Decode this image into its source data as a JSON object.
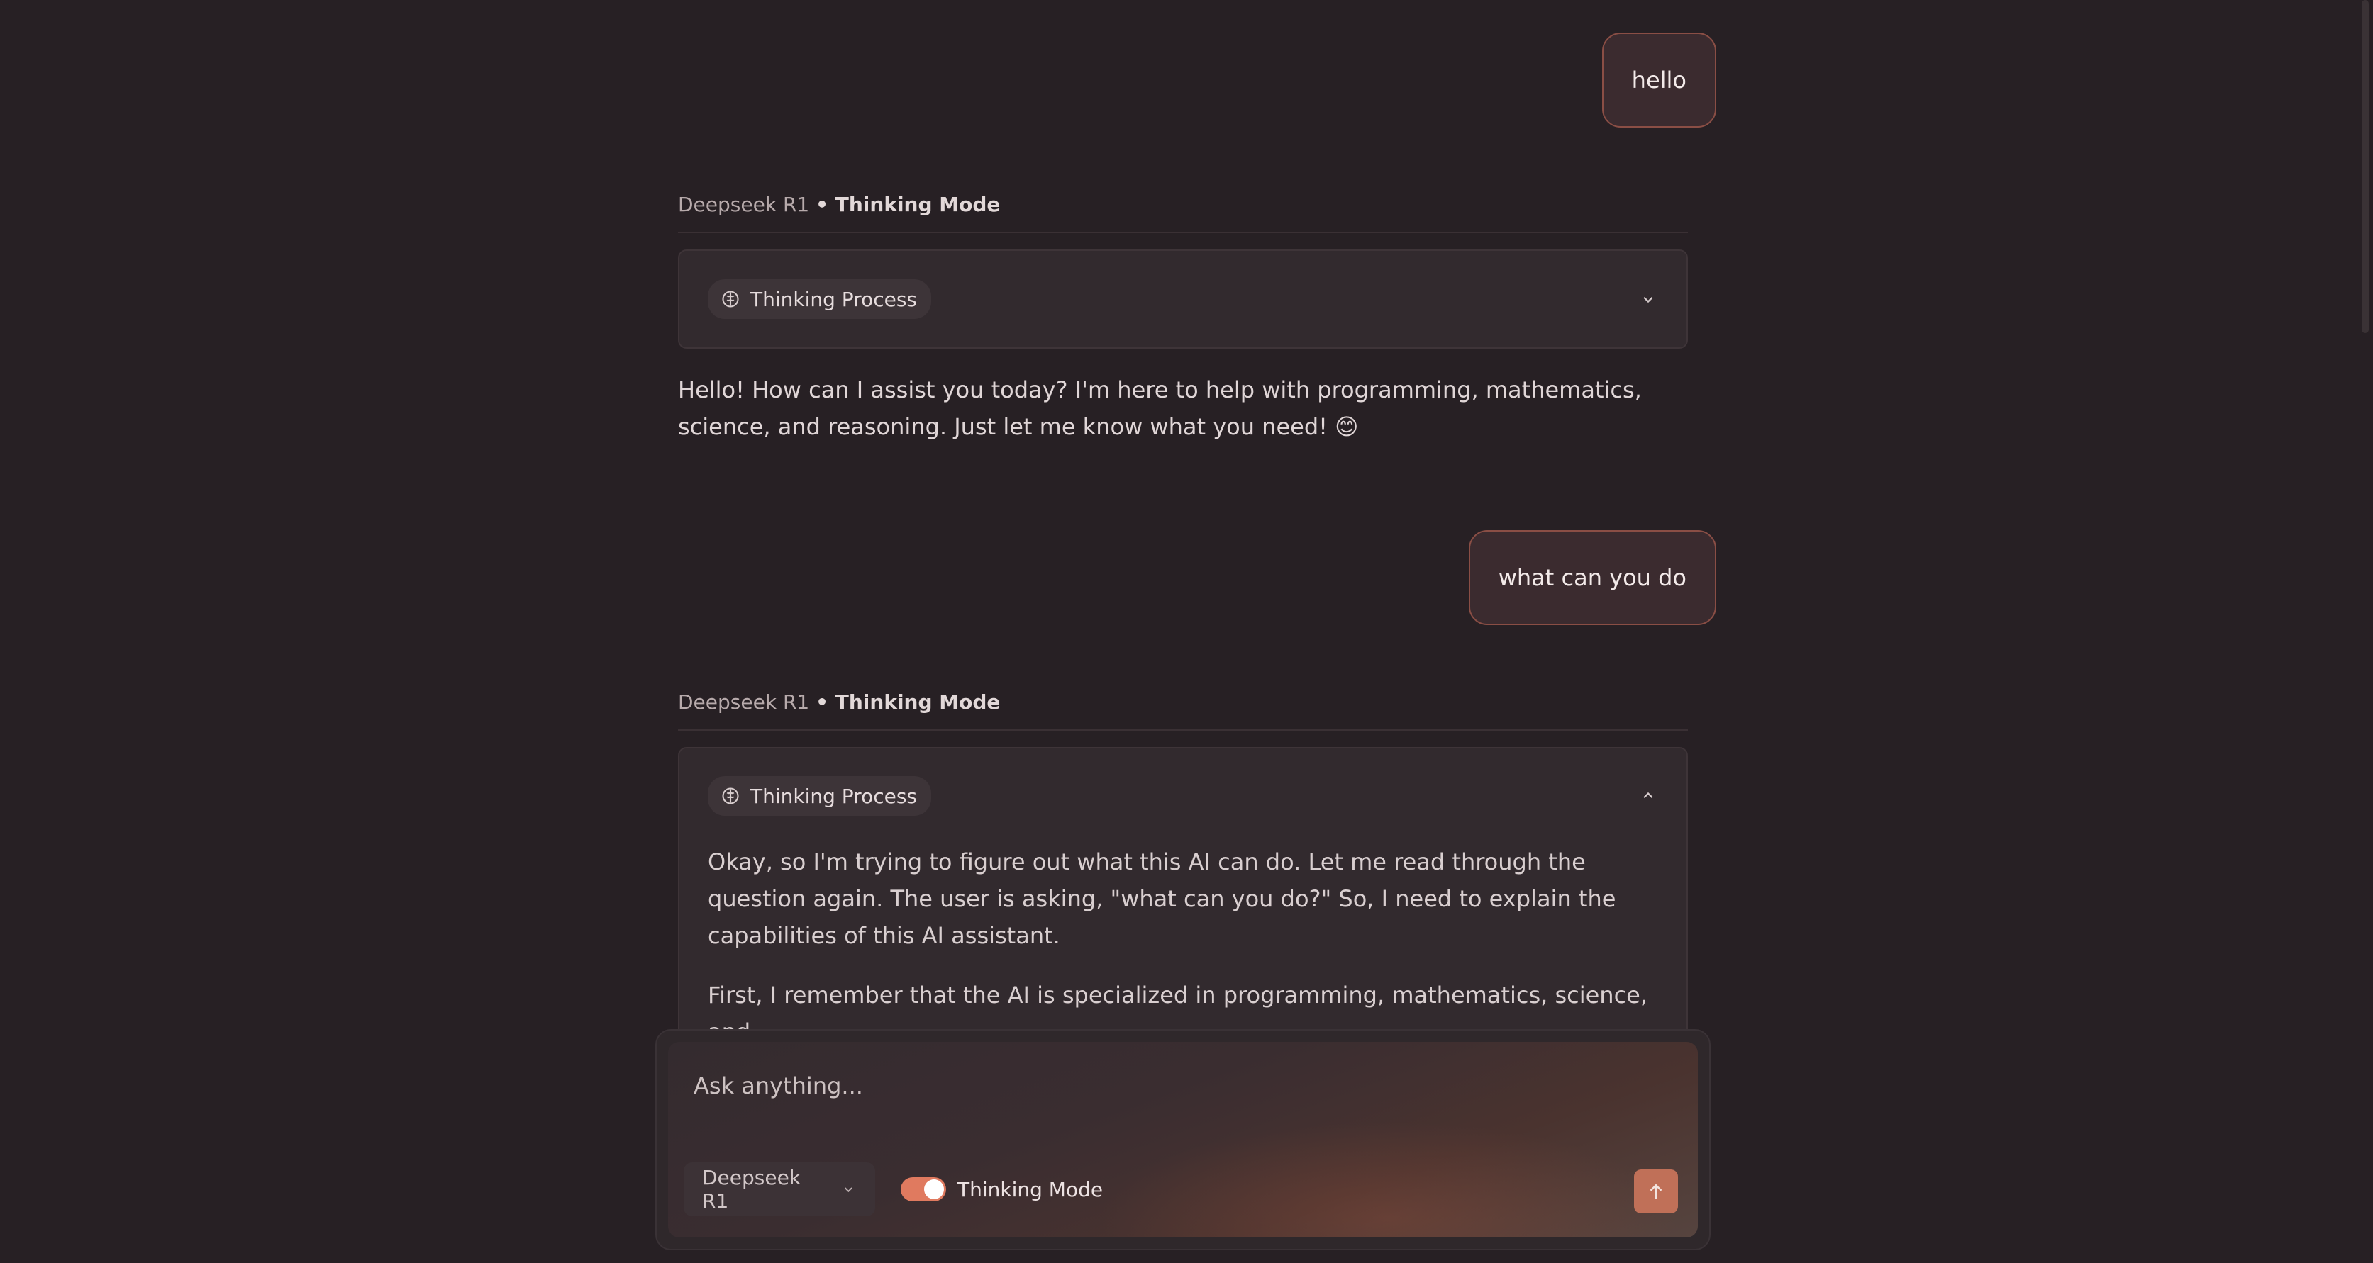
{
  "conversation": [
    {
      "role": "user",
      "text": "hello"
    },
    {
      "role": "assistant",
      "model": "Deepseek R1",
      "mode": "• Thinking Mode",
      "thinking_label": "Thinking Process",
      "thinking_expanded": false,
      "answer": "Hello! How can I assist you today? I'm here to help with programming, mathematics, science, and reasoning. Just let me know what you need! 😊"
    },
    {
      "role": "user",
      "text": "what can you do"
    },
    {
      "role": "assistant",
      "model": "Deepseek R1",
      "mode": "• Thinking Mode",
      "thinking_label": "Thinking Process",
      "thinking_expanded": true,
      "thinking_paragraphs": [
        "Okay, so I'm trying to figure out what this AI can do. Let me read through the question again. The user is asking, \"what can you do?\" So, I need to explain the capabilities of this AI assistant.",
        "First, I remember that the AI is specialized in programming, mathematics, science, and"
      ]
    }
  ],
  "composer": {
    "placeholder": "Ask anything...",
    "value": "",
    "model": "Deepseek R1",
    "thinking_mode_label": "Thinking Mode",
    "thinking_mode_on": true
  },
  "colors": {
    "background": "#272024",
    "accent": "#e07a5f",
    "user_bubble_border": "#8a4e45",
    "send_button": "#c07058"
  },
  "icons": {
    "thinking": "brain-icon",
    "collapse": "chevron-icon",
    "model_dropdown": "chevron-down-icon",
    "send": "arrow-up-icon"
  }
}
